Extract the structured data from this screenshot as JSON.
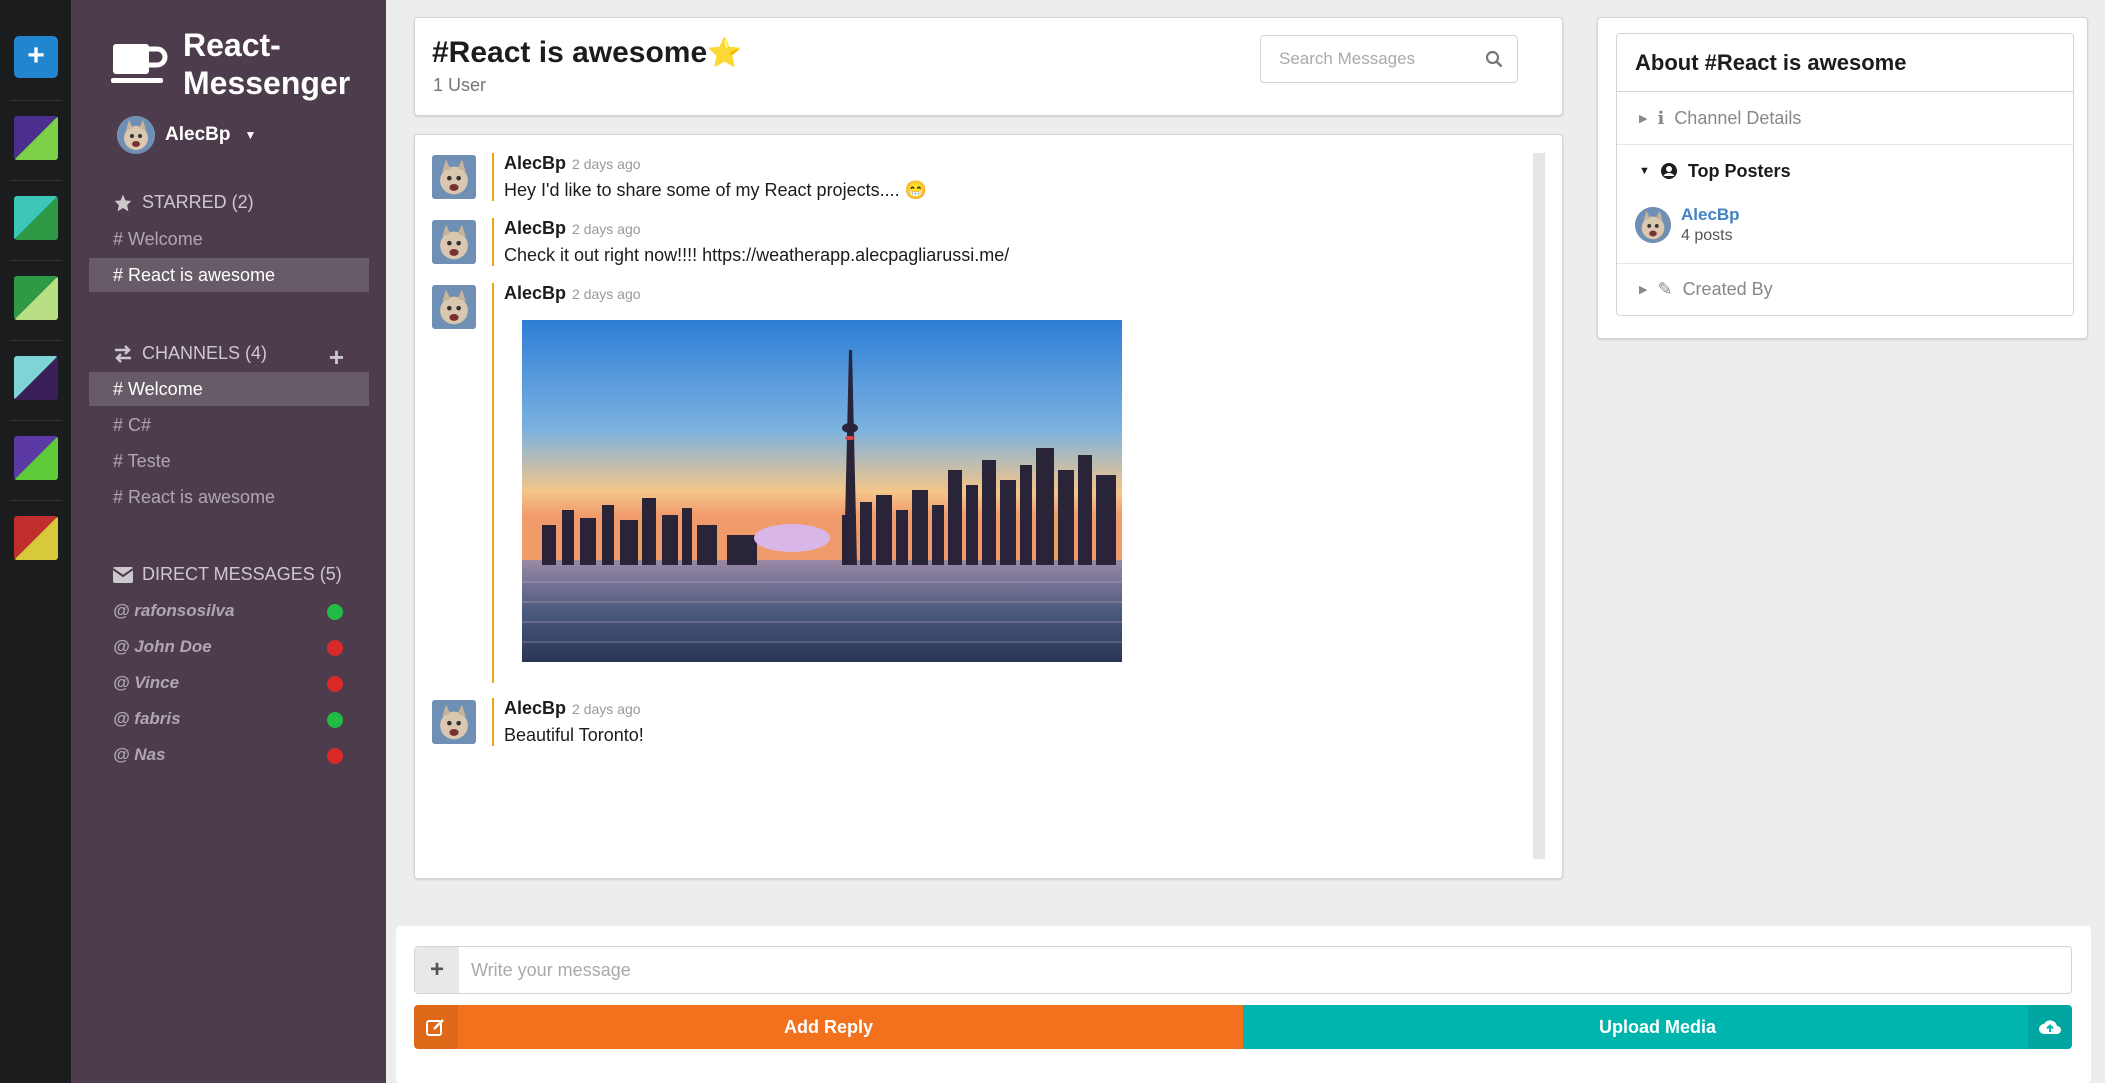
{
  "app": {
    "title_line1": "React-",
    "title_line2": "Messenger",
    "add_color_label": "+"
  },
  "colors": {
    "swatches": [
      {
        "primary": "#4b2f8f",
        "secondary": "#7cd04a"
      },
      {
        "primary": "#3cc6b8",
        "secondary": "#2e9a46"
      },
      {
        "primary": "#2e9a46",
        "secondary": "#b9df84"
      },
      {
        "primary": "#7fd4d8",
        "secondary": "#3a1f5a"
      },
      {
        "primary": "#5b3aa6",
        "secondary": "#5dcb3a"
      },
      {
        "primary": "#c22d2d",
        "secondary": "#d8c93a"
      }
    ]
  },
  "user": {
    "name": "AlecBp"
  },
  "starred": {
    "header": "STARRED (2)",
    "items": [
      "# Welcome",
      "# React is awesome"
    ]
  },
  "channels": {
    "header": "CHANNELS (4)",
    "items": [
      "# Welcome",
      "# C#",
      "# Teste",
      "# React is awesome"
    ]
  },
  "direct_messages": {
    "header": "DIRECT MESSAGES (5)",
    "items": [
      {
        "name": "@ rafonsosilva",
        "status_color": "#21ba45"
      },
      {
        "name": "@ John Doe",
        "status_color": "#db2828"
      },
      {
        "name": "@ Vince",
        "status_color": "#db2828"
      },
      {
        "name": "@ fabris",
        "status_color": "#21ba45"
      },
      {
        "name": "@ Nas",
        "status_color": "#db2828"
      }
    ]
  },
  "header": {
    "channel_name": "#React is awesome",
    "star": "⭐",
    "user_count": "1 User",
    "search_placeholder": "Search Messages"
  },
  "messages": [
    {
      "author": "AlecBp",
      "time": "2 days ago",
      "text": "Hey I'd like to share some of my React projects.... 😁"
    },
    {
      "author": "AlecBp",
      "time": "2 days ago",
      "text": "Check it out right now!!!! https://weatherapp.alecpagliarussi.me/"
    },
    {
      "author": "AlecBp",
      "time": "2 days ago",
      "text": ""
    },
    {
      "author": "AlecBp",
      "time": "2 days ago",
      "text": "Beautiful Toronto!"
    }
  ],
  "meta": {
    "title": "About #React is awesome",
    "channel_details": "Channel Details",
    "top_posters": "Top Posters",
    "poster_name": "AlecBp",
    "poster_count": "4 posts",
    "created_by": "Created By"
  },
  "form": {
    "input_placeholder": "Write your message",
    "add_label": "+",
    "reply_label": "Add Reply",
    "upload_label": "Upload Media"
  }
}
